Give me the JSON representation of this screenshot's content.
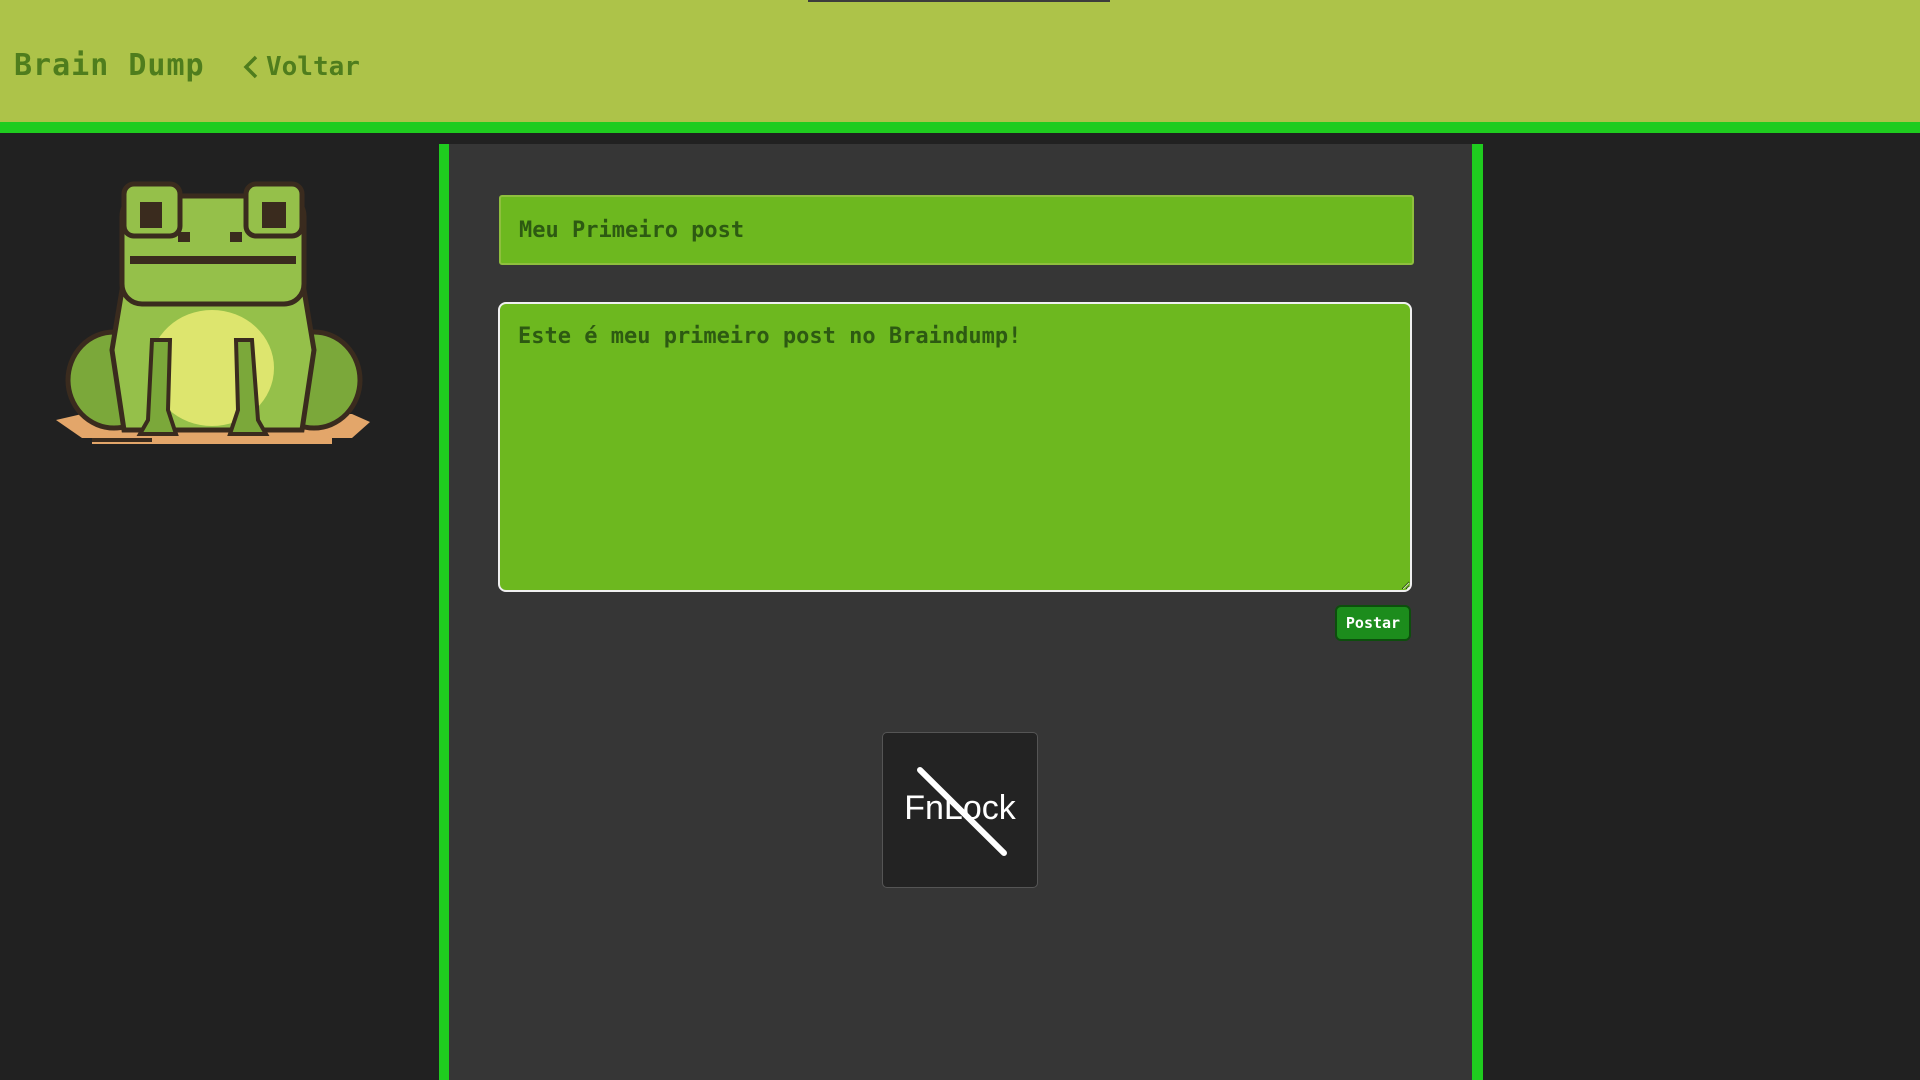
{
  "header": {
    "brand": "Brain Dump",
    "back_label": "Voltar"
  },
  "post_form": {
    "title_value": "Meu Primeiro post",
    "body_value": "Este é meu primeiro post no Braindump!",
    "submit_label": "Postar"
  },
  "overlay": {
    "fnlock_label": "FnLock"
  },
  "colors": {
    "header_bg": "#adc349",
    "accent_green": "#1fcc1f",
    "input_bg": "#6db81f",
    "button_bg": "#1c8c1c"
  },
  "icons": {
    "back": "chevron-left-icon",
    "mascot": "frog-image",
    "fnlock": "fnlock-disabled-icon"
  }
}
